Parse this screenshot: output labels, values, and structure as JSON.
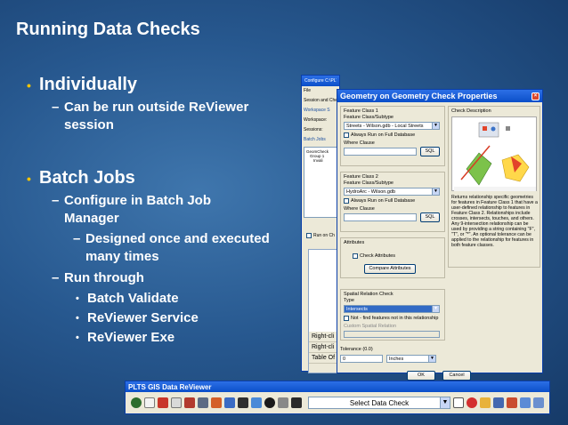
{
  "slide": {
    "title": "Running Data Checks",
    "bullets": {
      "individually": "Individually",
      "individually_sub": "Can be run outside ReViewer session",
      "batch": "Batch Jobs",
      "batch_sub1": "Configure in Batch Job Manager",
      "batch_sub1_sub": "Designed once and executed many times",
      "batch_sub2": "Run through",
      "run_through": [
        "Batch Validate",
        "ReViewer Service",
        "ReViewer Exe"
      ]
    }
  },
  "config_window": {
    "title": "Configure C:\\PLTS\\DataForService\\ConfigBatch\\revjob2.xml",
    "menu": "File",
    "rows": [
      "Session and Che",
      "Workspace S",
      "Workspace:",
      "Sessions:",
      "Batch Jobs"
    ],
    "tree": [
      "GeomCheck",
      "Group 1",
      "Invali"
    ],
    "run_on": "Run on Ch",
    "toc_items": [
      "Right-cli",
      "Right-cli",
      "Table Of"
    ]
  },
  "dialog": {
    "title": "Geometry on Geometry Check Properties",
    "fc1_label": "Feature Class 1",
    "fc1_subtype_label": "Feature Class/Subtype",
    "fc1_value": "Streets - Wilson.gdb - Local Streets",
    "always_run_1": "Always Run on Full Database",
    "where_clause_1": "Where Clause",
    "sql_1": "SQL",
    "fc2_label": "Feature Class 2",
    "fc2_subtype_label": "Feature Class/Subtype",
    "fc2_value": "HydroArc - Wilson.gdb",
    "always_run_2": "Always Run on Full Database",
    "where_clause_2": "Where Clause",
    "sql_2": "SQL",
    "attributes_label": "Attributes",
    "check_attributes": "Check Attributes",
    "compare_attributes": "Compare Attributes",
    "spatial_label": "Spatial Relation Check",
    "type_label": "Type",
    "type_value": "Intersects",
    "not_find": "Not - find features not in this relationship",
    "custom_spatial": "Custom Spatial Relation",
    "tolerance_label": "Tolerance (0.0)",
    "tolerance_value": "0",
    "units_value": "Inches",
    "ok": "OK",
    "cancel": "Cancel",
    "check_desc_label": "Check Description",
    "description": "Returns relationship specific geometries for features in Feature Class 1 that have a user-defined relationship to features in Feature Class 2. Relationships include crosses, intersects, touches, and others. Any 9-intersection relationship can be used by providing a string containing \"F\", \"T\", or \"*\". An optional tolerance can be applied to the relationship for features in both feature classes."
  },
  "toolbar": {
    "title": "PLTS GIS Data ReViewer",
    "select_check": "Select Data Check"
  },
  "colors": {
    "bullet_marker": "#f2c400",
    "titlebar": "#0b4fc9"
  }
}
